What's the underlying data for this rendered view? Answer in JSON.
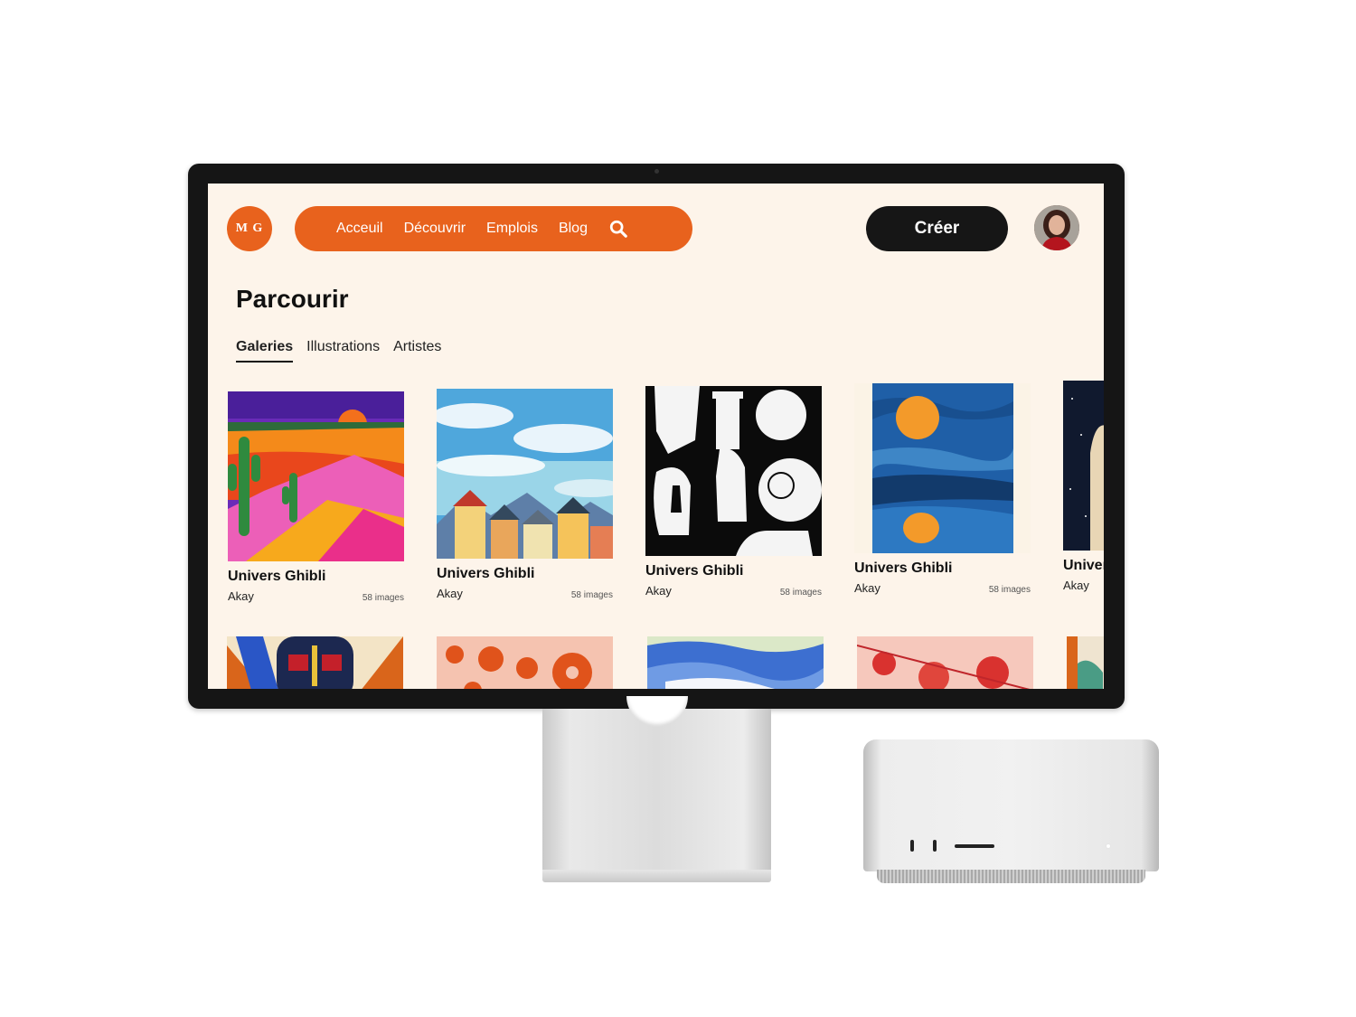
{
  "logo": {
    "text": "M G"
  },
  "nav": {
    "items": [
      {
        "label": "Acceuil"
      },
      {
        "label": "Découvrir"
      },
      {
        "label": "Emplois"
      },
      {
        "label": "Blog"
      }
    ]
  },
  "header": {
    "create_label": "Créer"
  },
  "page": {
    "title": "Parcourir"
  },
  "tabs": [
    {
      "label": "Galeries",
      "active": true
    },
    {
      "label": "Illustrations",
      "active": false
    },
    {
      "label": "Artistes",
      "active": false
    }
  ],
  "galleries": [
    {
      "title": "Univers Ghibli",
      "author": "Akay",
      "count": "58 images",
      "art": "desert"
    },
    {
      "title": "Univers Ghibli",
      "author": "Akay",
      "count": "58 images",
      "art": "village"
    },
    {
      "title": "Univers Ghibli",
      "author": "Akay",
      "count": "58 images",
      "art": "statues"
    },
    {
      "title": "Univers Ghibli",
      "author": "Akay",
      "count": "58 images",
      "art": "ocean"
    },
    {
      "title": "Univers Ghibli",
      "author": "Akay",
      "count": "",
      "art": "night"
    }
  ],
  "second_row_art": [
    "mask",
    "flowers-orange",
    "waves",
    "flowers-red",
    "abstract"
  ],
  "colors": {
    "accent": "#e8621d",
    "background": "#fdf4ea",
    "dark": "#161616"
  }
}
